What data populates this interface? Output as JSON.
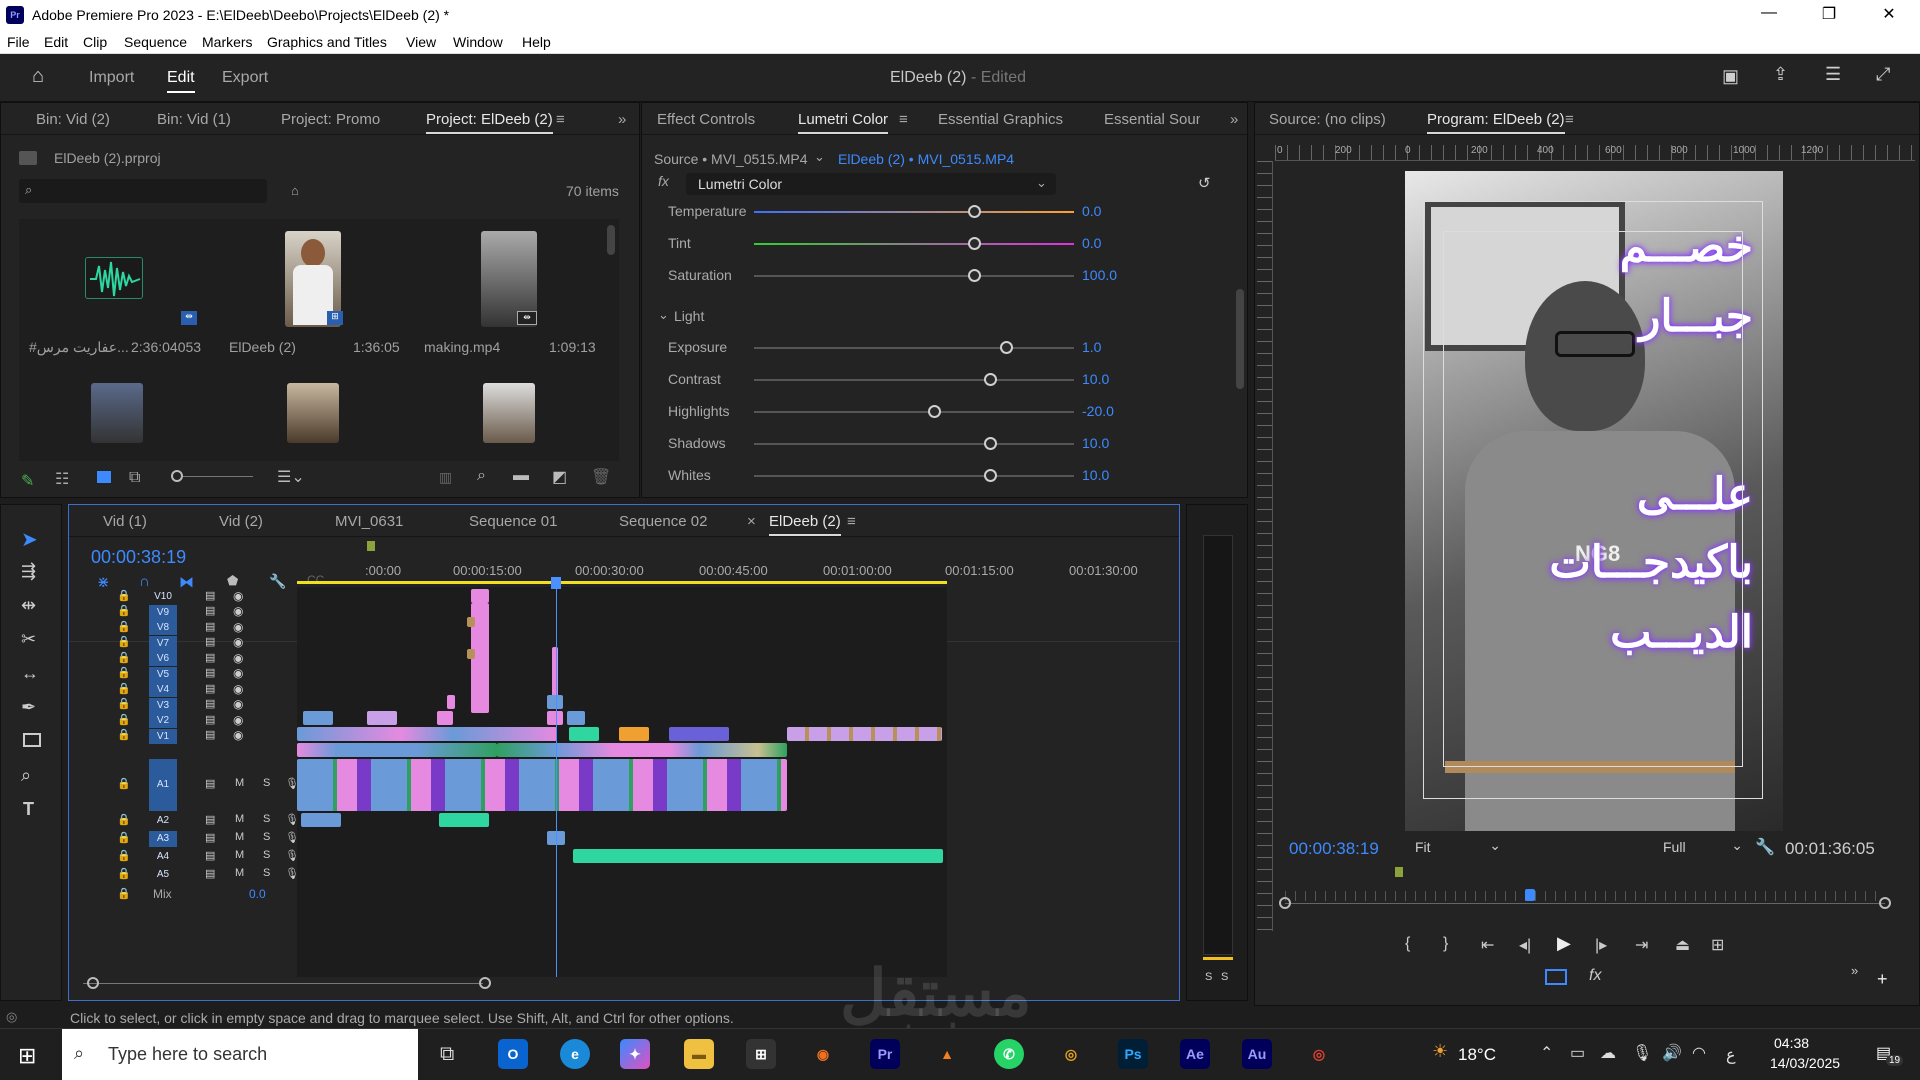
{
  "window": {
    "app_title": "Adobe Premiere Pro 2023 - E:\\ElDeeb\\Deebo\\Projects\\ElDeeb (2) *",
    "logo": "Pr"
  },
  "menu": [
    "File",
    "Edit",
    "Clip",
    "Sequence",
    "Markers",
    "Graphics and Titles",
    "View",
    "Window",
    "Help"
  ],
  "workspace": {
    "tabs": [
      "Import",
      "Edit",
      "Export"
    ],
    "active": "Edit",
    "project_name": "ElDeeb (2)",
    "project_state": "- Edited"
  },
  "project_panel": {
    "tabs": [
      "Bin: Vid (2)",
      "Bin: Vid (1)",
      "Project: Promo",
      "Project: ElDeeb (2)"
    ],
    "active_tab": "Project: ElDeeb (2)",
    "file": "ElDeeb (2).prproj",
    "search_placeholder": "",
    "item_count": "70 items",
    "items": [
      {
        "name": "#عفاريت مرس...",
        "duration": "2:36:04053"
      },
      {
        "name": "ElDeeb (2)",
        "duration": "1:36:05"
      },
      {
        "name": "making.mp4",
        "duration": "1:09:13"
      }
    ]
  },
  "effects_panel": {
    "tabs": [
      "Effect Controls",
      "Lumetri Color",
      "Essential Graphics",
      "Essential Sounc"
    ],
    "active_tab": "Lumetri Color",
    "source": "Source • MVI_0515.MP4",
    "sequence_clip": "ElDeeb (2) • MVI_0515.MP4",
    "effect": "Lumetri Color",
    "fx_label": "fx",
    "section_light": "Light",
    "color_sliders": [
      {
        "label": "Temperature",
        "value": "0.0",
        "pos": 0.5
      },
      {
        "label": "Tint",
        "value": "0.0",
        "pos": 0.5
      },
      {
        "label": "Saturation",
        "value": "100.0",
        "pos": 0.5
      }
    ],
    "light_sliders": [
      {
        "label": "Exposure",
        "value": "1.0",
        "pos": 0.6
      },
      {
        "label": "Contrast",
        "value": "10.0",
        "pos": 0.55
      },
      {
        "label": "Highlights",
        "value": "-20.0",
        "pos": 0.4
      },
      {
        "label": "Shadows",
        "value": "10.0",
        "pos": 0.55
      },
      {
        "label": "Whites",
        "value": "10.0",
        "pos": 0.55
      }
    ]
  },
  "program_monitor": {
    "tabs": [
      "Source: (no clips)",
      "Program: ElDeeb (2)"
    ],
    "active_tab": "Program: ElDeeb (2)",
    "ruler_labels": [
      "0",
      "200",
      "0",
      "200",
      "400",
      "600",
      "800",
      "1000",
      "1200"
    ],
    "overlay_lines": [
      "خصـــم",
      "جبـــار",
      "علـــى",
      "باكيدجـــات",
      "الديـــب"
    ],
    "shirt_text": "NG8",
    "timecode": "00:00:38:19",
    "fit": "Fit",
    "quality": "Full",
    "duration": "00:01:36:05"
  },
  "timeline": {
    "tabs": [
      "Vid (1)",
      "Vid (2)",
      "MVI_0631",
      "Sequence 01",
      "Sequence 02",
      "ElDeeb (2)"
    ],
    "active_tab": "ElDeeb (2)",
    "timecode": "00:00:38:19",
    "ruler": [
      ":00:00",
      "00:00:15:00",
      "00:00:30:00",
      "00:00:45:00",
      "00:01:00:00",
      "00:01:15:00",
      "00:01:30:00"
    ],
    "video_tracks": [
      "V10",
      "V9",
      "V8",
      "V7",
      "V6",
      "V5",
      "V4",
      "V3",
      "V2",
      "V1"
    ],
    "audio_tracks": [
      "A1",
      "A2",
      "A3",
      "A4",
      "A5"
    ],
    "track_m": "M",
    "track_s": "S",
    "mix_label": "Mix",
    "mix_value": "0.0",
    "meter_labels": [
      "S",
      "S"
    ]
  },
  "status_bar": "Click to select, or click in empty space and drag to marquee select. Use Shift, Alt, and Ctrl for other options.",
  "taskbar": {
    "search_placeholder": "Type here to search",
    "temperature": "18°C",
    "lang": "ع",
    "time": "04:38",
    "date": "14/03/2025",
    "notifications": "19"
  },
  "watermark": {
    "text": "مستقل",
    "sub": "mostaql.com"
  },
  "colors": {
    "accent": "#3d8aff",
    "playhead": "#4a90ff",
    "work_area": "#f0e020"
  }
}
